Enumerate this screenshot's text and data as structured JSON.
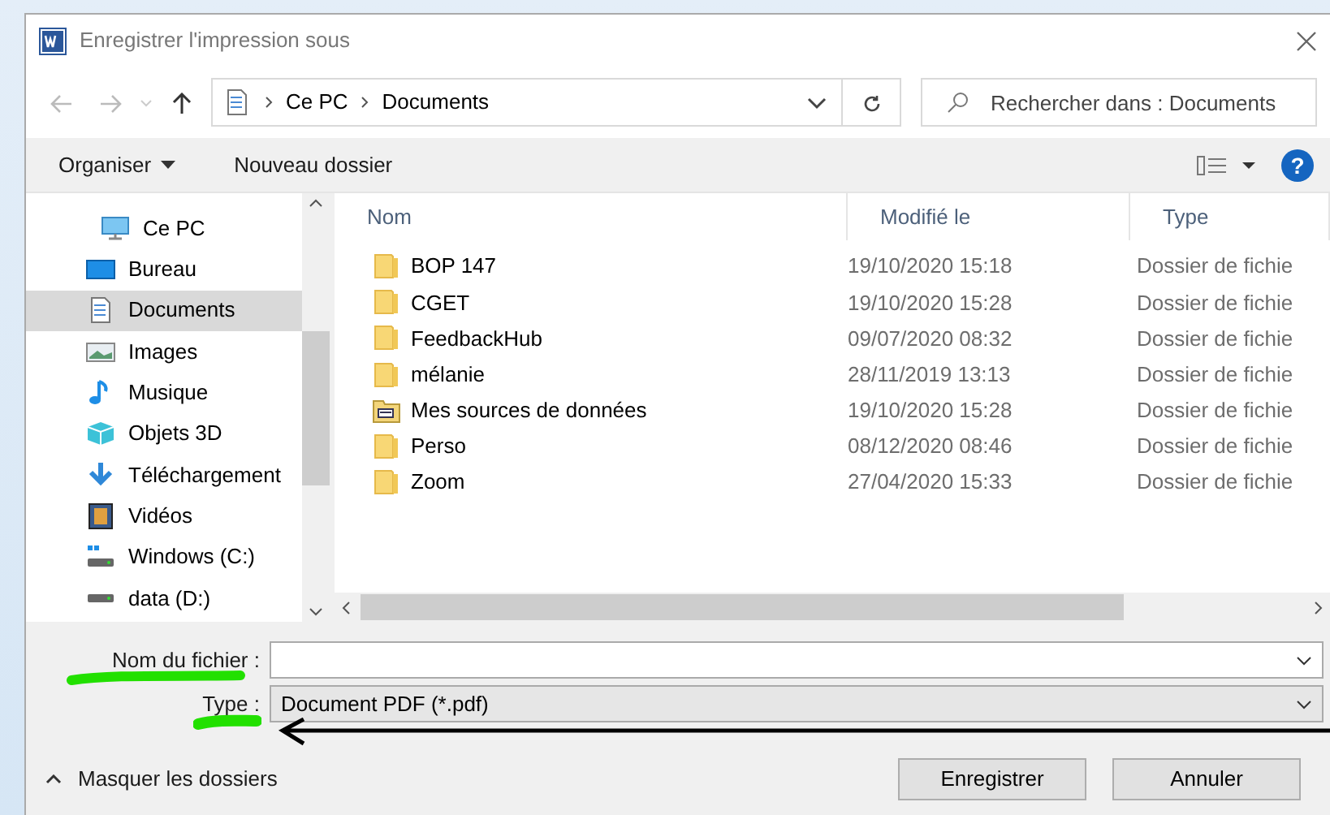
{
  "window": {
    "title": "Enregistrer l'impression sous"
  },
  "address": {
    "path": [
      "Ce PC",
      "Documents"
    ]
  },
  "search": {
    "placeholder": "Rechercher dans : Documents"
  },
  "toolbar": {
    "organize": "Organiser",
    "new_folder": "Nouveau dossier",
    "help": "?"
  },
  "sidebar": {
    "items": [
      {
        "label": "Ce PC",
        "kind": "pc",
        "selected": false,
        "children": [
          {
            "label": "Bureau",
            "kind": "desktop",
            "selected": false
          },
          {
            "label": "Documents",
            "kind": "documents",
            "selected": true
          },
          {
            "label": "Images",
            "kind": "images",
            "selected": false
          },
          {
            "label": "Musique",
            "kind": "music",
            "selected": false
          },
          {
            "label": "Objets 3D",
            "kind": "objects3d",
            "selected": false
          },
          {
            "label": "Téléchargement",
            "kind": "downloads",
            "selected": false
          },
          {
            "label": "Vidéos",
            "kind": "videos",
            "selected": false
          },
          {
            "label": "Windows (C:)",
            "kind": "system_drive",
            "selected": false
          },
          {
            "label": "data (D:)",
            "kind": "drive",
            "selected": false
          }
        ]
      }
    ]
  },
  "columns": [
    "Nom",
    "Modifié le",
    "Type"
  ],
  "files": [
    {
      "name": "BOP 147",
      "modified": "19/10/2020 15:18",
      "type": "Dossier de fichie",
      "kind": "folder"
    },
    {
      "name": "CGET",
      "modified": "19/10/2020 15:28",
      "type": "Dossier de fichie",
      "kind": "folder"
    },
    {
      "name": "FeedbackHub",
      "modified": "09/07/2020 08:32",
      "type": "Dossier de fichie",
      "kind": "folder"
    },
    {
      "name": "mélanie",
      "modified": "28/11/2019 13:13",
      "type": "Dossier de fichie",
      "kind": "folder"
    },
    {
      "name": "Mes sources de données",
      "modified": "19/10/2020 15:28",
      "type": "Dossier de fichie",
      "kind": "data_folder"
    },
    {
      "name": "Perso",
      "modified": "08/12/2020 08:46",
      "type": "Dossier de fichie",
      "kind": "folder"
    },
    {
      "name": "Zoom",
      "modified": "27/04/2020 15:33",
      "type": "Dossier de fichie",
      "kind": "folder"
    }
  ],
  "footer": {
    "filename_label": "Nom du fichier :",
    "type_label": "Type :",
    "type_value": "Document PDF (*.pdf)",
    "toggle": "Masquer les dossiers",
    "buttons": [
      "Enregistrer",
      "Annuler"
    ]
  }
}
